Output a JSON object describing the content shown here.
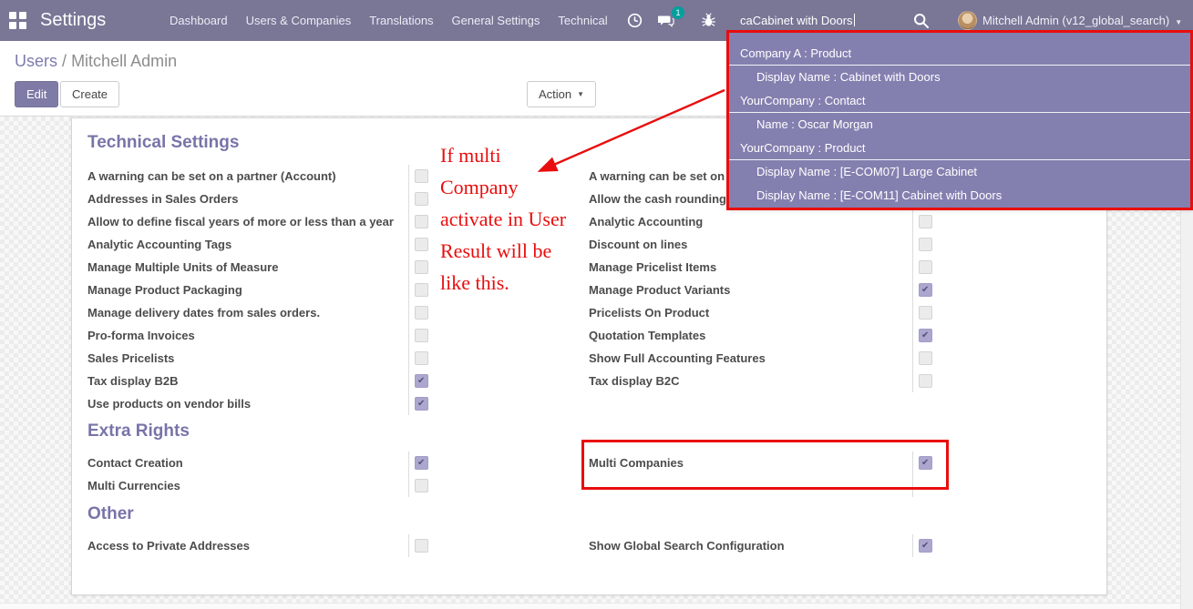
{
  "navbar": {
    "brand": "Settings",
    "menu": [
      "Dashboard",
      "Users & Companies",
      "Translations",
      "General Settings",
      "Technical"
    ],
    "message_badge": "1",
    "search_value": "caCabinet with Doors",
    "user_name": "Mitchell Admin (v12_global_search)",
    "icons": [
      "apps-grid-icon",
      "activities-clock-icon",
      "messages-icon",
      "debug-bug-icon",
      "search-icon",
      "chevron-down-icon"
    ],
    "colors": {
      "bg": "#797696",
      "badge": "#00a09d"
    }
  },
  "control_panel": {
    "breadcrumb": {
      "parent": "Users",
      "separator": "/",
      "current": "Mitchell Admin"
    },
    "buttons": {
      "edit": "Edit",
      "create": "Create",
      "action": "Action"
    }
  },
  "search_dropdown": {
    "bg": "#8380b0",
    "rows": [
      {
        "type": "category",
        "text": "Company A : Product"
      },
      {
        "type": "item",
        "text": "Display Name : Cabinet with Doors"
      },
      {
        "type": "category",
        "text": "YourCompany : Contact"
      },
      {
        "type": "item",
        "text": "Name : Oscar Morgan"
      },
      {
        "type": "category",
        "text": "YourCompany : Product"
      },
      {
        "type": "item",
        "text": "Display Name : [E-COM07] Large Cabinet"
      },
      {
        "type": "item",
        "text": "Display Name : [E-COM11] Cabinet with Doors"
      }
    ]
  },
  "annotation": {
    "note_lines": [
      "If multi",
      "Company",
      "activate in User",
      "Result will be",
      "like this."
    ],
    "color": "#e90d0d"
  },
  "form": {
    "sections": [
      {
        "title": "Technical Settings",
        "left": [
          {
            "label": "A warning can be set on a partner (Account)",
            "checked": false
          },
          {
            "label": "Addresses in Sales Orders",
            "checked": false
          },
          {
            "label": "Allow to define fiscal years of more or less than a year",
            "checked": false
          },
          {
            "label": "Analytic Accounting Tags",
            "checked": false
          },
          {
            "label": "Manage Multiple Units of Measure",
            "checked": false
          },
          {
            "label": "Manage Product Packaging",
            "checked": false
          },
          {
            "label": "Manage delivery dates from sales orders.",
            "checked": false
          },
          {
            "label": "Pro-forma Invoices",
            "checked": false
          },
          {
            "label": "Sales Pricelists",
            "checked": false
          },
          {
            "label": "Tax display B2B",
            "checked": true
          },
          {
            "label": "Use products on vendor bills",
            "checked": true
          }
        ],
        "right": [
          {
            "label": "A warning can be set on a",
            "checked": false
          },
          {
            "label": "Allow the cash rounding r",
            "checked": false
          },
          {
            "label": "Analytic Accounting",
            "checked": false
          },
          {
            "label": "Discount on lines",
            "checked": false
          },
          {
            "label": "Manage Pricelist Items",
            "checked": false
          },
          {
            "label": "Manage Product Variants",
            "checked": true
          },
          {
            "label": "Pricelists On Product",
            "checked": false
          },
          {
            "label": "Quotation Templates",
            "checked": true
          },
          {
            "label": "Show Full Accounting Features",
            "checked": false
          },
          {
            "label": "Tax display B2C",
            "checked": false
          }
        ]
      },
      {
        "title": "Extra Rights",
        "left": [
          {
            "label": "Contact Creation",
            "checked": true
          },
          {
            "label": "Multi Currencies",
            "checked": false
          }
        ],
        "right": [
          {
            "label": "Multi Companies",
            "checked": true
          }
        ]
      },
      {
        "title": "Other",
        "left": [
          {
            "label": "Access to Private Addresses",
            "checked": false
          }
        ],
        "right": [
          {
            "label": "Show Global Search Configuration",
            "checked": true
          }
        ]
      }
    ]
  }
}
